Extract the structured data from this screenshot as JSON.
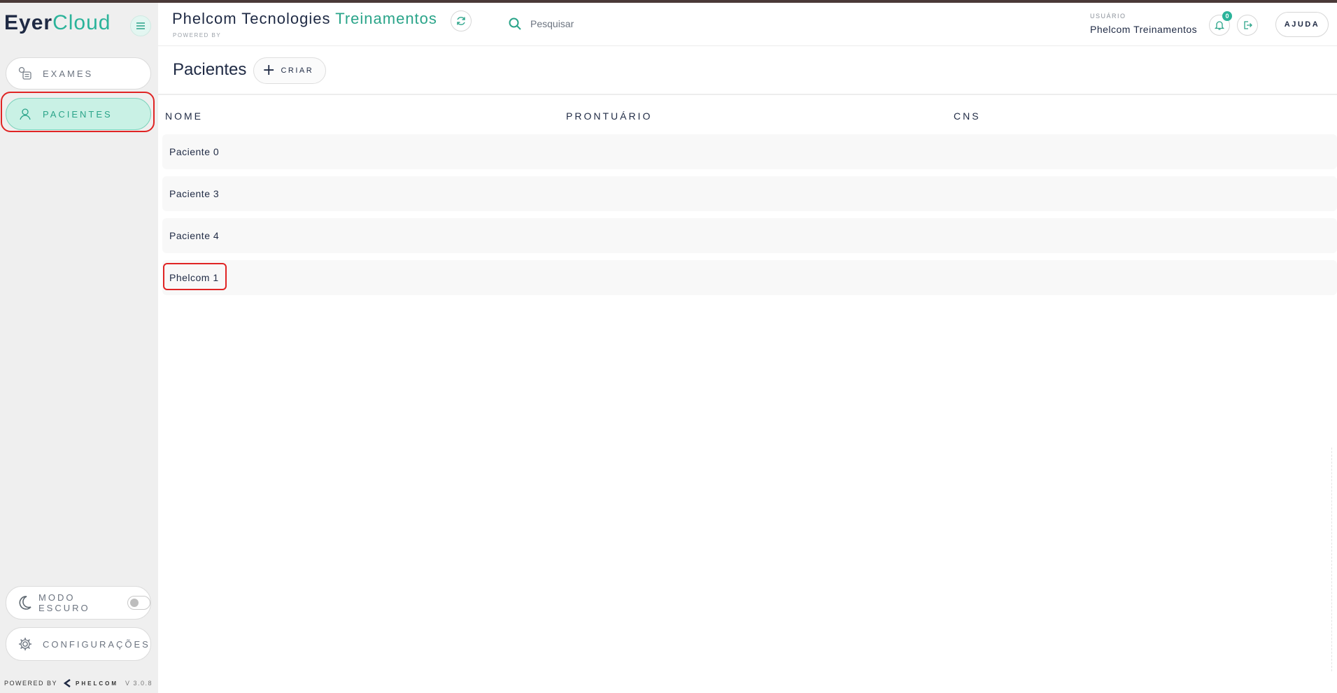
{
  "sidebar": {
    "logo_part1": "Eyer",
    "logo_part2": "Cloud",
    "items": [
      {
        "label": "EXAMES"
      },
      {
        "label": "PACIENTES"
      }
    ],
    "dark_mode_label": "MODO ESCURO",
    "dark_mode_on": false,
    "settings_label": "CONFIGURAÇÕES",
    "footer": {
      "powered": "POWERED BY",
      "brand": "PHELCOM",
      "version": "V 3.0.8"
    }
  },
  "header": {
    "org_part1": "Phelcom Tecnologies",
    "org_part2": "Treinamentos",
    "powered_by": "POWERED BY",
    "search_placeholder": "Pesquisar",
    "user_caption": "USUÁRIO",
    "user_name": "Phelcom Treinamentos",
    "notification_count": "0",
    "help_label": "AJUDA"
  },
  "page": {
    "title": "Pacientes",
    "create_label": "CRIAR"
  },
  "table": {
    "columns": [
      "NOME",
      "PRONTUÁRIO",
      "CNS"
    ],
    "rows": [
      {
        "nome": "Paciente 0",
        "prontuario": "",
        "cns": ""
      },
      {
        "nome": "Paciente 3",
        "prontuario": "",
        "cns": ""
      },
      {
        "nome": "Paciente 4",
        "prontuario": "",
        "cns": ""
      },
      {
        "nome": "Phelcom 1",
        "prontuario": "",
        "cns": ""
      }
    ]
  },
  "colors": {
    "accent": "#2bb39a",
    "text": "#1f2a44",
    "highlight": "#e02424"
  }
}
